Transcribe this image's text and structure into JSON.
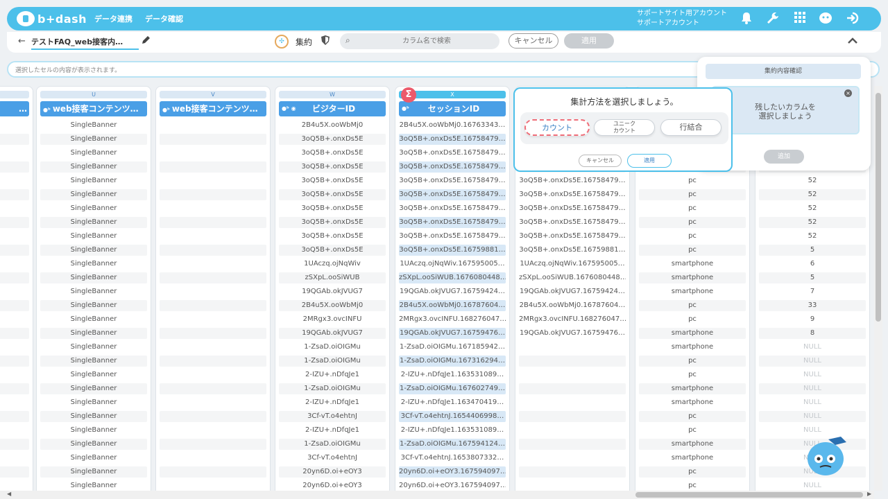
{
  "app": {
    "logo_text": "b+dash",
    "nav": [
      "データ連携",
      "データ確認"
    ],
    "account_line1": "サポートサイト用アカウント",
    "account_line2": "サポートアカウント"
  },
  "icons": {
    "bell": "bell-icon",
    "wrench": "wrench-icon",
    "grid": "apps-grid-icon",
    "chat": "support-chat-icon",
    "logout": "logout-icon"
  },
  "toolbar": {
    "back": "←",
    "file_name": "テストFAQ_web接客内…",
    "agg_label": "集約",
    "search_placeholder": "カラム名で検索",
    "cancel": "キャンセル",
    "apply": "適用",
    "collapse": "^"
  },
  "cell_bar": {
    "placeholder": "選択したセルの内容が表示されます。"
  },
  "columns": [
    {
      "letter": "",
      "header": "…",
      "values": []
    },
    {
      "letter": "U",
      "header": "web接客コンテンツ…",
      "values": [
        "SingleBanner",
        "SingleBanner",
        "SingleBanner",
        "SingleBanner",
        "SingleBanner",
        "SingleBanner",
        "SingleBanner",
        "SingleBanner",
        "SingleBanner",
        "SingleBanner",
        "SingleBanner",
        "SingleBanner",
        "SingleBanner",
        "SingleBanner",
        "SingleBanner",
        "SingleBanner",
        "SingleBanner",
        "SingleBanner",
        "SingleBanner",
        "SingleBanner",
        "SingleBanner",
        "SingleBanner",
        "SingleBanner",
        "SingleBanner",
        "SingleBanner",
        "SingleBanner",
        "SingleBanner"
      ]
    },
    {
      "letter": "V",
      "header": "web接客コンテンツ…",
      "values": []
    },
    {
      "letter": "W",
      "header": "ビジターID",
      "values": [
        "2B4u5X.ooWbMj0",
        "3oQ5B+.onxDs5E",
        "3oQ5B+.onxDs5E",
        "3oQ5B+.onxDs5E",
        "3oQ5B+.onxDs5E",
        "3oQ5B+.onxDs5E",
        "3oQ5B+.onxDs5E",
        "3oQ5B+.onxDs5E",
        "3oQ5B+.onxDs5E",
        "3oQ5B+.onxDs5E",
        "1UAczq.ojNqWiv",
        "zSXpL.ooSiWUB",
        "19QGAb.okJVUG7",
        "2B4u5X.ooWbMj0",
        "2MRgx3.ovcINFU",
        "19QGAb.okJVUG7",
        "1-ZsaD.oiOIGMu",
        "1-ZsaD.oiOIGMu",
        "2-IZU+.nDfqJe1",
        "1-ZsaD.oiOIGMu",
        "2-IZU+.nDfqJe1",
        "3Cf-vT.o4ehtnJ",
        "2-IZU+.nDfqJe1",
        "1-ZsaD.oiOIGMu",
        "3Cf-vT.o4ehtnJ",
        "20yn6D.oi+eOY3",
        "20yn6D.oi+eOY3"
      ]
    },
    {
      "letter": "X",
      "header": "セッションID",
      "values": [
        "2B4u5X.ooWbMj0.16763343…",
        "3oQ5B+.onxDs5E.16758479…",
        "3oQ5B+.onxDs5E.16758479…",
        "3oQ5B+.onxDs5E.16758479…",
        "3oQ5B+.onxDs5E.16758479…",
        "3oQ5B+.onxDs5E.16758479…",
        "3oQ5B+.onxDs5E.16758479…",
        "3oQ5B+.onxDs5E.16758479…",
        "3oQ5B+.onxDs5E.16758479…",
        "3oQ5B+.onxDs5E.16759881…",
        "1UAczq.ojNqWiv.167595005…",
        "zSXpL.ooSiWUB.1676080448…",
        "19QGAb.okJVUG7.16759424…",
        "2B4u5X.ooWbMj0.16787604…",
        "2MRgx3.ovcINFU.168276047…",
        "19QGAb.okJVUG7.16759476…",
        "1-ZsaD.oiOIGMu.167185942…",
        "1-ZsaD.oiOIGMu.167316294…",
        "2-IZU+.nDfqJe1.163531089…",
        "1-ZsaD.oiOIGMu.167602749…",
        "2-IZU+.nDfqJe1.163470419…",
        "3Cf-vT.o4ehtnJ.1654406998…",
        "2-IZU+.nDfqJe1.163531089…",
        "1-ZsaD.oiOIGMu.167594124…",
        "3Cf-vT.o4ehtnJ.1653807332…",
        "20yn6D.oi+eOY3.167594097…",
        "20yn6D.oi+eOY3.167594097…"
      ]
    },
    {
      "letter": "",
      "header": "",
      "values": [
        "",
        "",
        "",
        "",
        "3oQ5B+.onxDs5E.16758479…",
        "3oQ5B+.onxDs5E.16758479…",
        "3oQ5B+.onxDs5E.16758479…",
        "3oQ5B+.onxDs5E.16758479…",
        "3oQ5B+.onxDs5E.16758479…",
        "3oQ5B+.onxDs5E.16759881…",
        "1UAczq.ojNqWiv.167595005…",
        "zSXpL.ooSiWUB.1676080448…",
        "19QGAb.okJVUG7.16759424…",
        "2B4u5X.ooWbMj0.16787604…",
        "2MRgx3.ovcINFU.168276047…",
        "19QGAb.okJVUG7.16759476…",
        "",
        "",
        "",
        "",
        "",
        "",
        "",
        "",
        "",
        "",
        ""
      ]
    },
    {
      "letter": "",
      "header": "",
      "values": [
        "",
        "",
        "",
        "",
        "pc",
        "pc",
        "pc",
        "pc",
        "pc",
        "pc",
        "smartphone",
        "smartphone",
        "smartphone",
        "pc",
        "pc",
        "smartphone",
        "smartphone",
        "pc",
        "pc",
        "smartphone",
        "smartphone",
        "pc",
        "pc",
        "smartphone",
        "smartphone",
        "pc",
        "pc"
      ]
    },
    {
      "letter": "",
      "header": "",
      "values": [
        "",
        "",
        "",
        "",
        "52",
        "52",
        "52",
        "52",
        "52",
        "5",
        "6",
        "5",
        "7",
        "33",
        "9",
        "8",
        "NULL",
        "NULL",
        "NULL",
        "NULL",
        "NULL",
        "NULL",
        "NULL",
        "NULL",
        "NULL",
        "NULL",
        "NULL"
      ]
    }
  ],
  "popup": {
    "title": "集計方法を選択しましょう。",
    "opt_count": "カウント",
    "opt_unique_1": "ユニーク",
    "opt_unique_2": "カウント",
    "opt_join": "行結合",
    "cancel": "キャンセル",
    "apply": "適用"
  },
  "side_panel": {
    "title": "集約内容確認",
    "hint_1": "残したいカラムを",
    "hint_2": "選択しましょう",
    "add": "追加"
  },
  "colors": {
    "accent": "#4cc0ea",
    "header_blue": "#4a9fe6",
    "sigma_red": "#ec5a6b"
  }
}
